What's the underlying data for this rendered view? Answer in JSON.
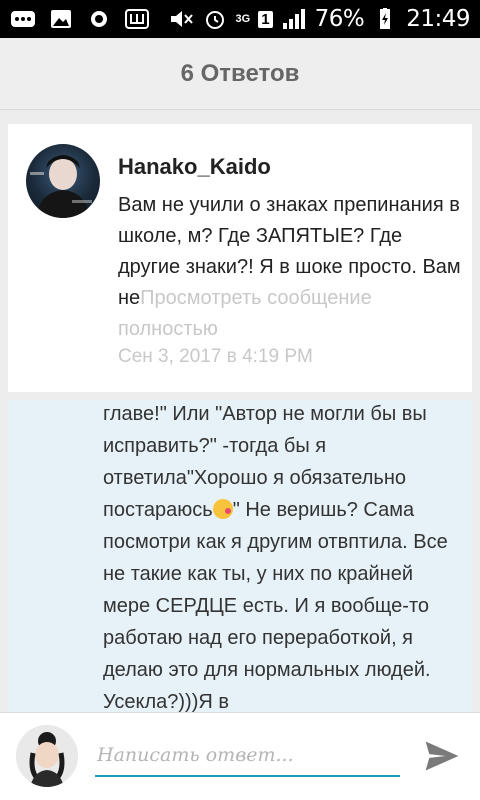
{
  "status_bar": {
    "network": "3G",
    "sim": "1",
    "battery": "76%",
    "time": "21:49"
  },
  "header": {
    "title": "6 Ответов"
  },
  "comment": {
    "author": "Hanako_Kaido",
    "text": "Вам не учили о знаках препинания в школе, м? Где ЗАПЯТЫЕ? Где другие знаки?! Я в шоке просто. Вам не",
    "more_link": "Просмотреть сообщение полностью",
    "date": "Сен 3, 2017 в 4:19 PM"
  },
  "thread": {
    "text_before_emoji": "главе!\" Или \"Автор не могли бы вы исправить?\" -тогда бы я ответила\"Хорошо я обязательно постараюсь",
    "text_after_emoji": "\" Не веришь? Сама посмотри как я другим отвптила. Все не такие как ты, у них по крайней мере СЕРДЦЕ есть. И я вообще-то работаю над его переработкой, я делаю это для нормальных людей. Усекла?)))Я в"
  },
  "reply": {
    "placeholder": "Написать ответ..."
  },
  "icons": [
    "menu-dots-icon",
    "image-icon",
    "record-icon",
    "shop-icon",
    "mute-icon",
    "alarm-icon",
    "signal-icon",
    "battery-icon",
    "kiss-emoji",
    "send-icon"
  ],
  "colors": {
    "accent": "#1aa0b5",
    "panel_bg": "#e6f2f8",
    "muted_text": "#c8c8c8"
  }
}
